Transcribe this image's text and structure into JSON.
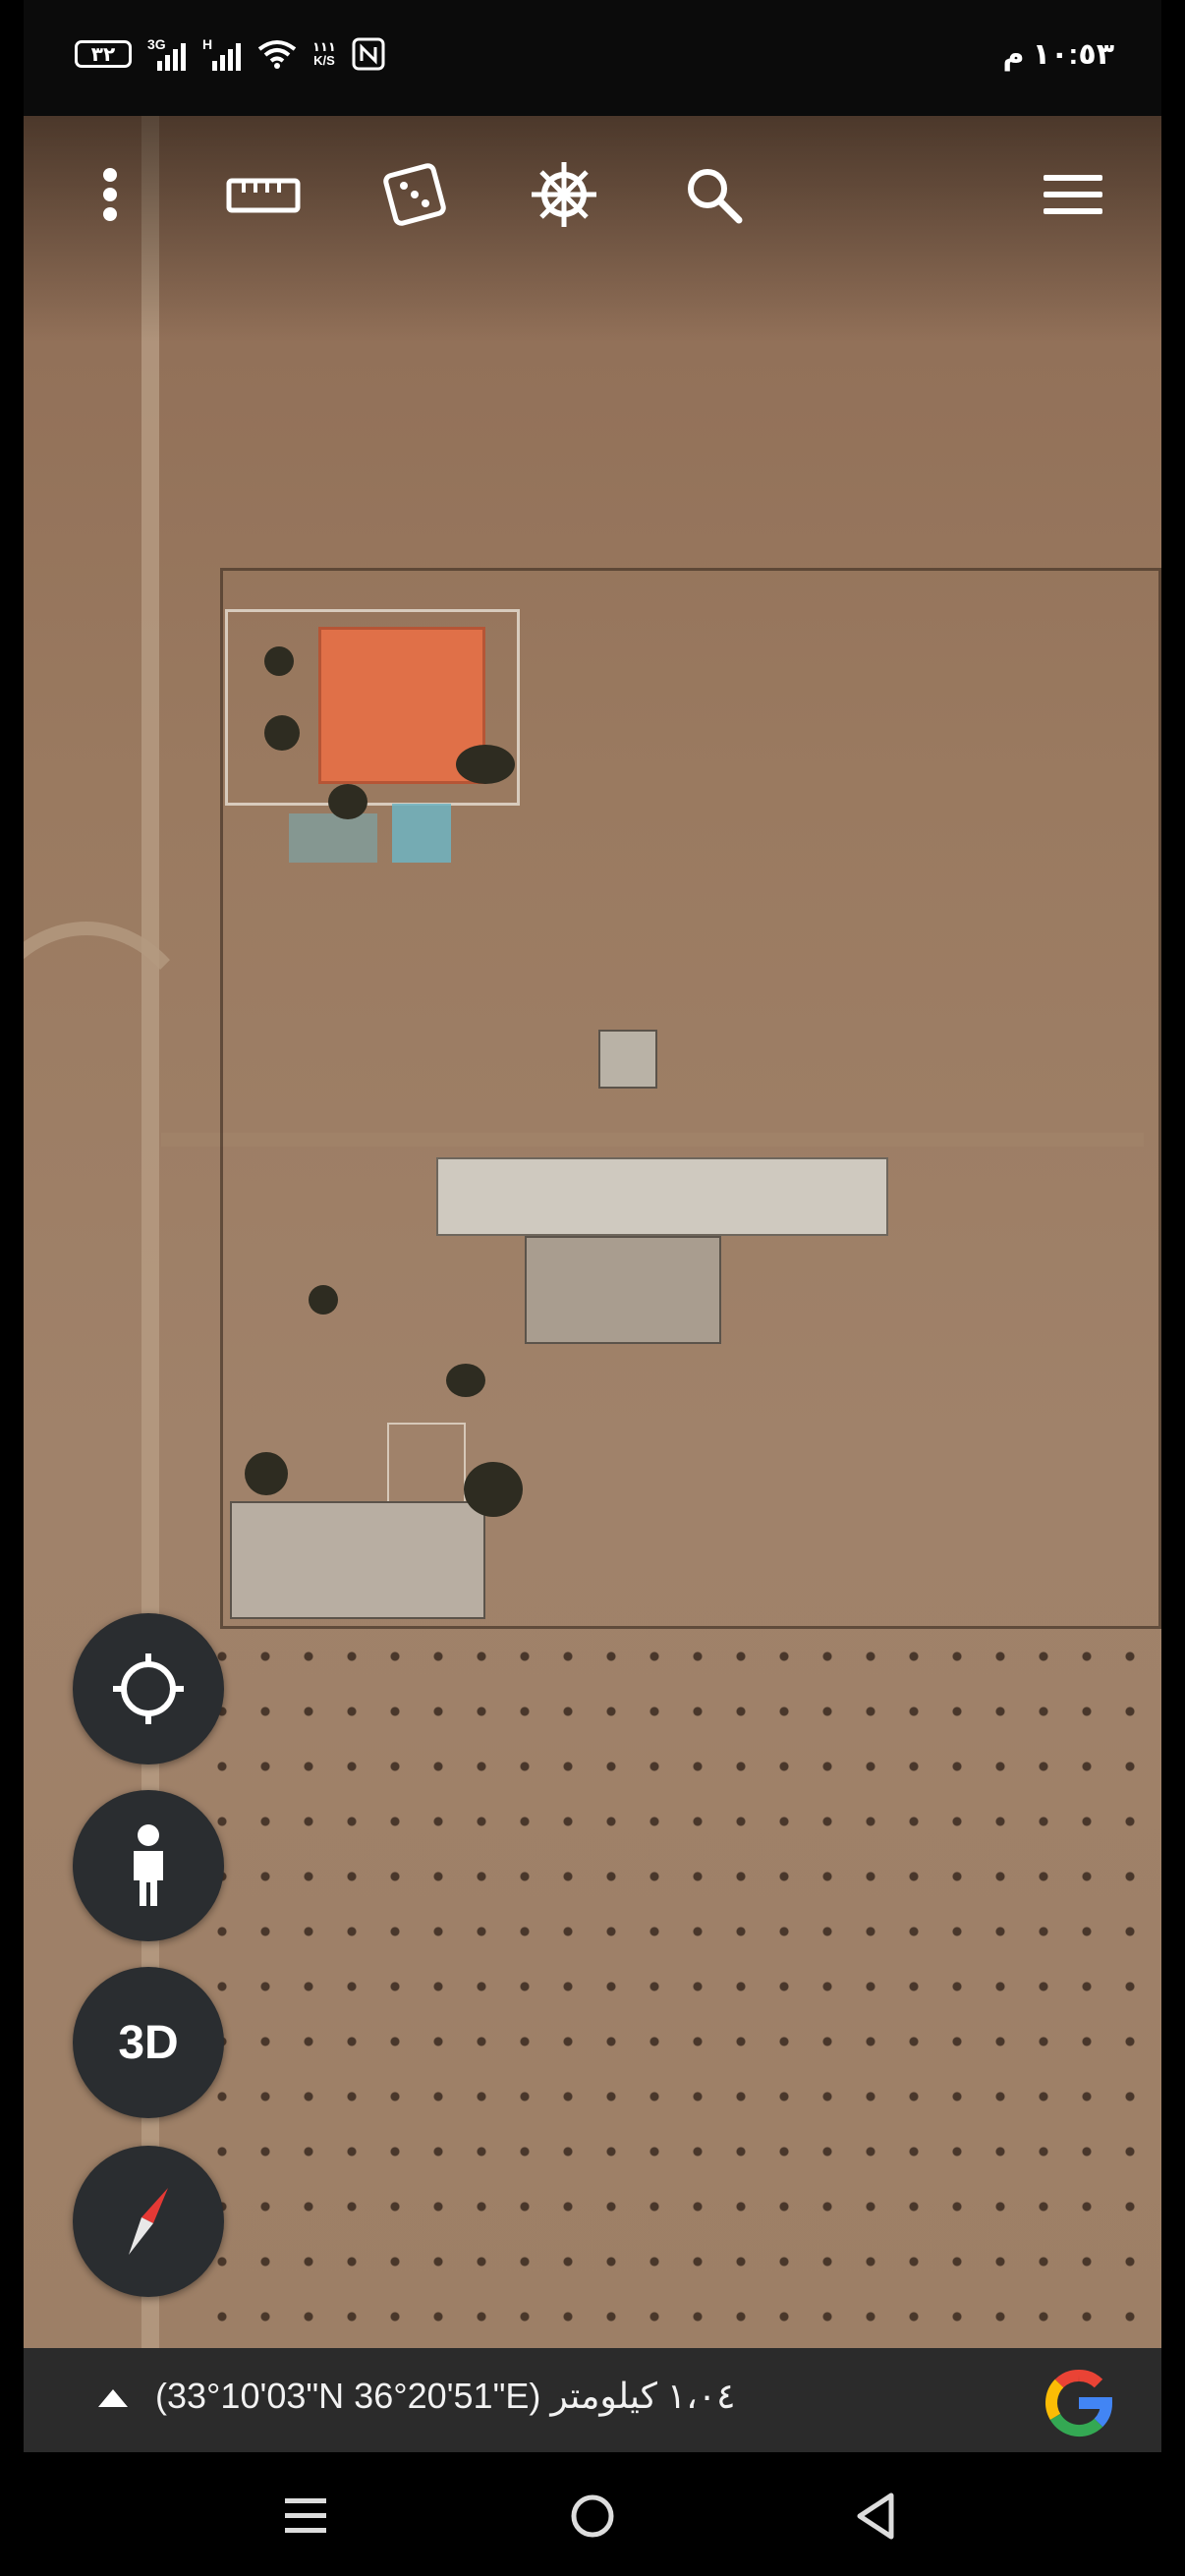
{
  "status_bar": {
    "battery": "٣٢",
    "signal_1_label": "3G",
    "signal_2_label": "H",
    "speed_value": "١١١",
    "speed_unit": "K/S",
    "time": "١٠:٥٣ م"
  },
  "toolbar": {
    "icons": [
      "more-vert-icon",
      "ruler-icon",
      "dice-icon",
      "ship-wheel-icon",
      "search-icon",
      "menu-icon"
    ]
  },
  "fabs": {
    "location_icon": "crosshair-icon",
    "pegman_icon": "pegman-icon",
    "view_3d_label": "3D",
    "compass_icon": "compass-icon"
  },
  "info_bar": {
    "coordinates_text": "(33°10'03\"N 36°20'51\"E) ١،٠٤ كيلومتر",
    "brand_icon": "google-g-logo"
  },
  "nav_bar": {
    "icons": [
      "recent-apps-icon",
      "home-icon",
      "back-icon"
    ]
  },
  "colors": {
    "fab_background": "#2a2d30",
    "info_bar_background": "#2b2b2b",
    "roof": "#e07048"
  }
}
